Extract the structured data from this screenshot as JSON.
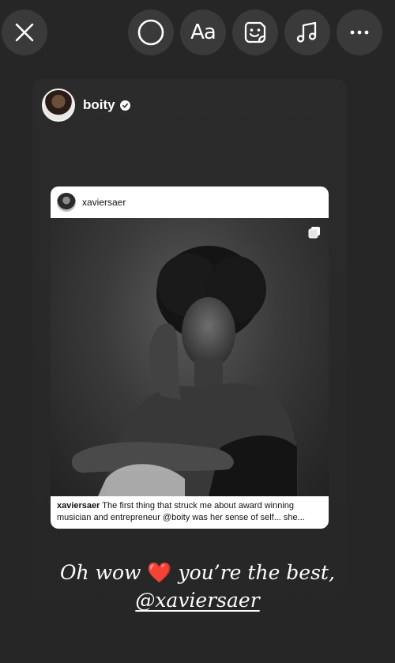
{
  "toolbar": {
    "close_icon": "close-icon",
    "draw_icon": "circle-icon",
    "text_label": "Aa",
    "sticker_icon": "sticker-icon",
    "music_icon": "music-icon",
    "more_icon": "more-icon"
  },
  "story": {
    "author": "boity",
    "verified": true,
    "shared_post": {
      "username": "xaviersaer",
      "caption_user": "xaviersaer",
      "caption_text": " The first thing that struck me about award winning musician and entrepreneur @boity was her sense of self... she..."
    },
    "text_part1": "Oh wow",
    "emoji": "❤️",
    "text_part2": "you’re the best,",
    "mention": "@xaviersaer"
  },
  "colors": {
    "background": "#262626",
    "toolbar_button": "#3a3a3a",
    "heart": "#e0182d"
  }
}
